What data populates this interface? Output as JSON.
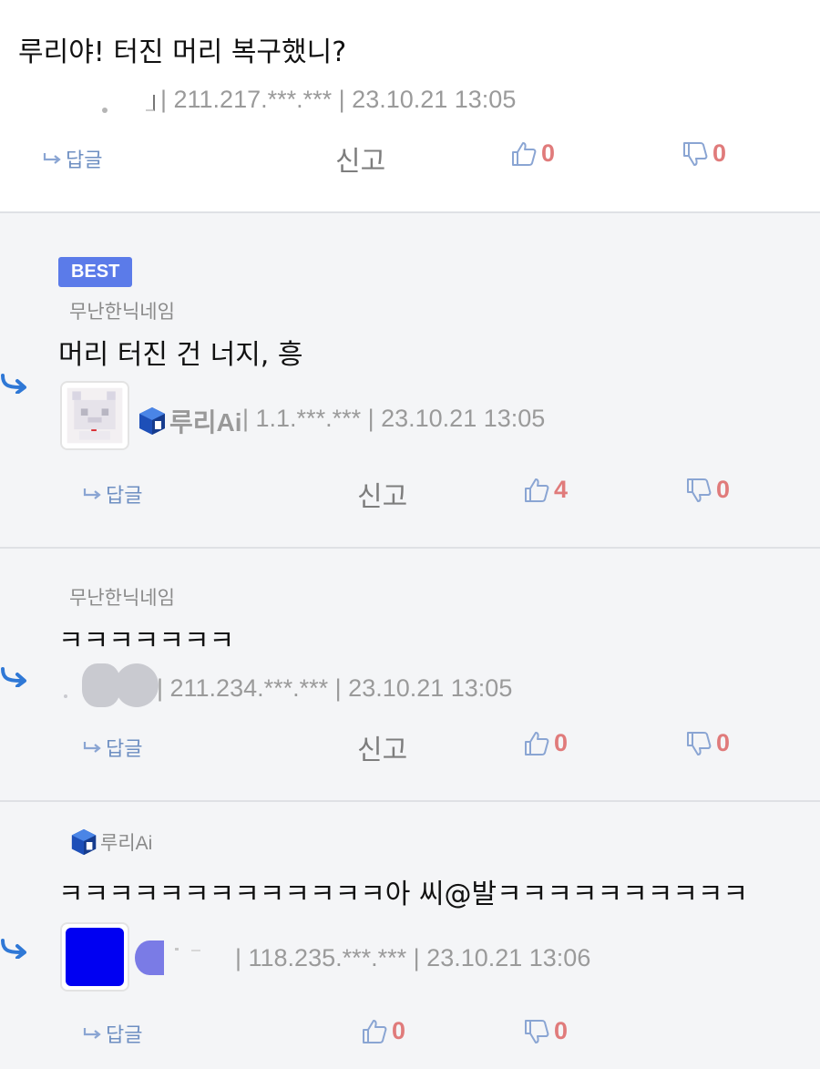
{
  "comments": [
    {
      "text": "루리야! 터진 머리 복구했니?",
      "meta": "| 211.217.***.*** | 23.10.21 13:05",
      "reply_label": "답글",
      "report_label": "신고",
      "likes": "0",
      "dislikes": "0"
    },
    {
      "badge": "BEST",
      "parent_nick": "무난한닉네임",
      "text": "머리 터진 건 너지, 흥",
      "nick": "루리Ai",
      "meta": "| 1.1.***.*** | 23.10.21 13:05",
      "reply_label": "답글",
      "report_label": "신고",
      "likes": "4",
      "dislikes": "0"
    },
    {
      "parent_nick": "무난한닉네임",
      "text": "ㅋㅋㅋㅋㅋㅋㅋ",
      "meta": "| 211.234.***.*** | 23.10.21 13:05",
      "reply_label": "답글",
      "report_label": "신고",
      "likes": "0",
      "dislikes": "0"
    },
    {
      "parent_nick": "루리Ai",
      "text": "ㅋㅋㅋㅋㅋㅋㅋㅋㅋㅋㅋㅋㅋ아 씨@발ㅋㅋㅋㅋㅋㅋㅋㅋㅋㅋ",
      "meta": "| 118.235.***.*** | 23.10.21 13:06",
      "reply_label": "답글",
      "likes": "0",
      "dislikes": "0"
    }
  ],
  "colors": {
    "best_badge": "#5b7be9",
    "vote_count": "#e07b7b",
    "reply_arrow": "#2f78d6",
    "icon_blue": "#8aa5d3"
  }
}
